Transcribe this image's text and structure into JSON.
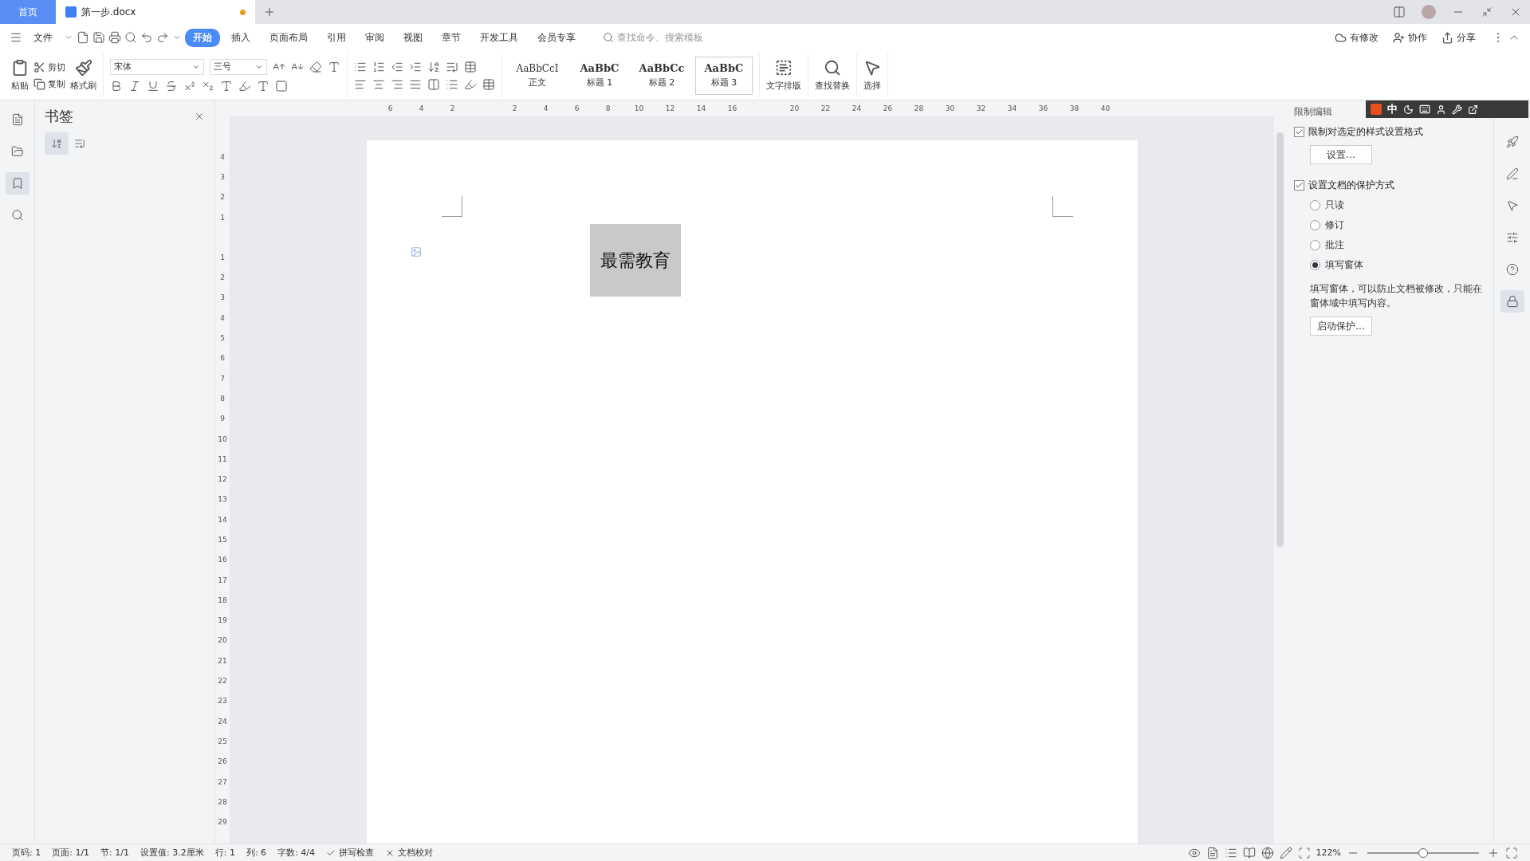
{
  "tabs": [
    {
      "label": "首页",
      "kind": "home",
      "selected": false
    },
    {
      "label": "第一步.docx",
      "kind": "doc",
      "selected": true,
      "modified": true
    }
  ],
  "menu": {
    "file": "文件",
    "tabs": [
      {
        "label": "开始",
        "selected": true
      },
      {
        "label": "插入",
        "selected": false
      },
      {
        "label": "页面布局",
        "selected": false
      },
      {
        "label": "引用",
        "selected": false
      },
      {
        "label": "审阅",
        "selected": false
      },
      {
        "label": "视图",
        "selected": false
      },
      {
        "label": "章节",
        "selected": false
      },
      {
        "label": "开发工具",
        "selected": false
      },
      {
        "label": "会员专享",
        "selected": false
      }
    ],
    "search": {
      "placeholder": "查找命令、搜索模板"
    },
    "actions": [
      "有修改",
      "协作",
      "分享"
    ]
  },
  "ribbon": {
    "paste": "粘贴",
    "cut": "剪切",
    "copy": "复制",
    "format_painter": "格式刷",
    "font": "宋体",
    "size": "三号",
    "styles": [
      {
        "preview": "AaBbCcI",
        "label": "正文",
        "selected": false
      },
      {
        "preview": "AaBbC",
        "label": "标题 1",
        "selected": false
      },
      {
        "preview": "AaBbCc",
        "label": "标题 2",
        "selected": false
      },
      {
        "preview": "AaBbC",
        "label": "标题 3",
        "selected": true
      }
    ],
    "tools": [
      "文字排版",
      "查找替换",
      "选择"
    ]
  },
  "bookmark_panel": {
    "title": "书签"
  },
  "ruler": {
    "top": [
      {
        "label": "6"
      },
      {
        "label": "4"
      },
      {
        "label": "2"
      },
      {
        "label": "2",
        "gap_before": true
      },
      {
        "label": "4"
      },
      {
        "label": "6"
      },
      {
        "label": "8"
      },
      {
        "label": "10"
      },
      {
        "label": "12"
      },
      {
        "label": "14"
      },
      {
        "label": "16"
      },
      {
        "label": "20",
        "gap_before": true
      },
      {
        "label": "22"
      },
      {
        "label": "24"
      },
      {
        "label": "26"
      },
      {
        "label": "28"
      },
      {
        "label": "30"
      },
      {
        "label": "32"
      },
      {
        "label": "34"
      },
      {
        "label": "36"
      },
      {
        "label": "38"
      },
      {
        "label": "40"
      }
    ],
    "left": [
      {
        "label": "4"
      },
      {
        "label": "3"
      },
      {
        "label": "2"
      },
      {
        "label": "1"
      },
      {
        "label": "1",
        "gap_before": true
      },
      {
        "label": "2"
      },
      {
        "label": "3"
      },
      {
        "label": "4"
      },
      {
        "label": "5"
      },
      {
        "label": "6"
      },
      {
        "label": "7"
      },
      {
        "label": "8"
      },
      {
        "label": "9"
      },
      {
        "label": "10"
      },
      {
        "label": "11"
      },
      {
        "label": "12"
      },
      {
        "label": "13"
      },
      {
        "label": "14"
      },
      {
        "label": "15"
      },
      {
        "label": "16"
      },
      {
        "label": "17"
      },
      {
        "label": "18"
      },
      {
        "label": "19"
      },
      {
        "label": "20"
      },
      {
        "label": "21"
      },
      {
        "label": "22"
      },
      {
        "label": "23"
      },
      {
        "label": "24"
      },
      {
        "label": "25"
      },
      {
        "label": "26"
      },
      {
        "label": "27"
      },
      {
        "label": "28"
      },
      {
        "label": "29"
      }
    ]
  },
  "document": {
    "text": "最需教育"
  },
  "restrict_panel": {
    "title": "限制编辑",
    "format_limit": {
      "label": "限制对选定的样式设置格式",
      "checked": true,
      "button": "设置..."
    },
    "protect": {
      "label": "设置文档的保护方式",
      "checked": true,
      "options": [
        {
          "label": "只读",
          "selected": false
        },
        {
          "label": "修订",
          "selected": false
        },
        {
          "label": "批注",
          "selected": false
        },
        {
          "label": "填写窗体",
          "selected": true
        }
      ],
      "hint": "填写窗体，可以防止文档被修改，只能在窗体域中填写内容。",
      "button": "启动保护..."
    }
  },
  "ime_bar": {
    "mode": "中"
  },
  "status_bar": {
    "items": [
      "页码: 1",
      "页面: 1/1",
      "节: 1/1",
      "设置值: 3.2厘米",
      "行: 1",
      "列: 6",
      "字数: 4/4"
    ],
    "checks": [
      "拼写检查",
      "文档校对"
    ],
    "zoom": "122%",
    "zoom_slider": {
      "level": 0.5
    }
  }
}
